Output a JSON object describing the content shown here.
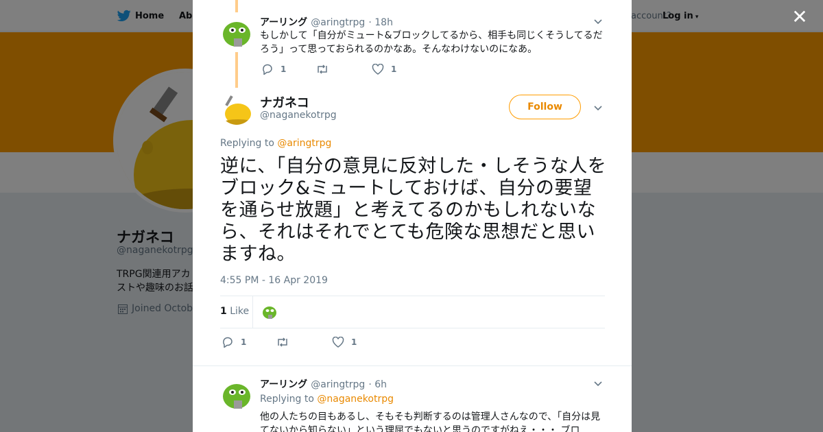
{
  "nav": {
    "home_label": "Home",
    "about_label": "Abo",
    "account_text": "account?",
    "login_label": "Log in"
  },
  "profile": {
    "name": "ナガネコ",
    "handle": "@naganekotrpg",
    "bio_line1": "TRPG関連用アカ",
    "bio_line2": "ストや趣味のお話",
    "joined": "Joined Octobe"
  },
  "colors": {
    "accent": "#e98900",
    "banner": "#ff9c00",
    "thread_line": "#ffcc8a"
  },
  "tweets": [
    {
      "name": "アーリング",
      "handle": "@aringtrpg",
      "time": "· 18h",
      "text": "もしかして「自分がミュート&ブロックしてるから、相手も同じくそうしてるだろう」って思っておられるのかなあ。そんなわけないのになあ。",
      "replies": "1",
      "likes": "1"
    }
  ],
  "focus": {
    "name": "ナガネコ",
    "handle": "@naganekotrpg",
    "follow_label": "Follow",
    "replying_prefix": "Replying to",
    "replying_to": "@aringtrpg",
    "text": "逆に、「自分の意見に反対した・しそうな人をブロック&ミュートしておけば、自分の要望を通らせ放題」と考えてるのかもしれないなら、それはそれでとても危険な思想だと思いますね。",
    "timestamp": "4:55 PM - 16 Apr 2019",
    "like_count": "1",
    "like_label": "Like",
    "replies": "1",
    "likes": "1"
  },
  "reply": {
    "name": "アーリング",
    "handle": "@aringtrpg",
    "time": "· 6h",
    "replying_prefix": "Replying to",
    "replying_to": "@naganekotrpg",
    "text": "他の人たちの目もあるし、そもそも判断するのは管理人さんなので、「自分は見てないから知らない」という理屈でもないと思うのですがねえ・・・ ブロ"
  }
}
